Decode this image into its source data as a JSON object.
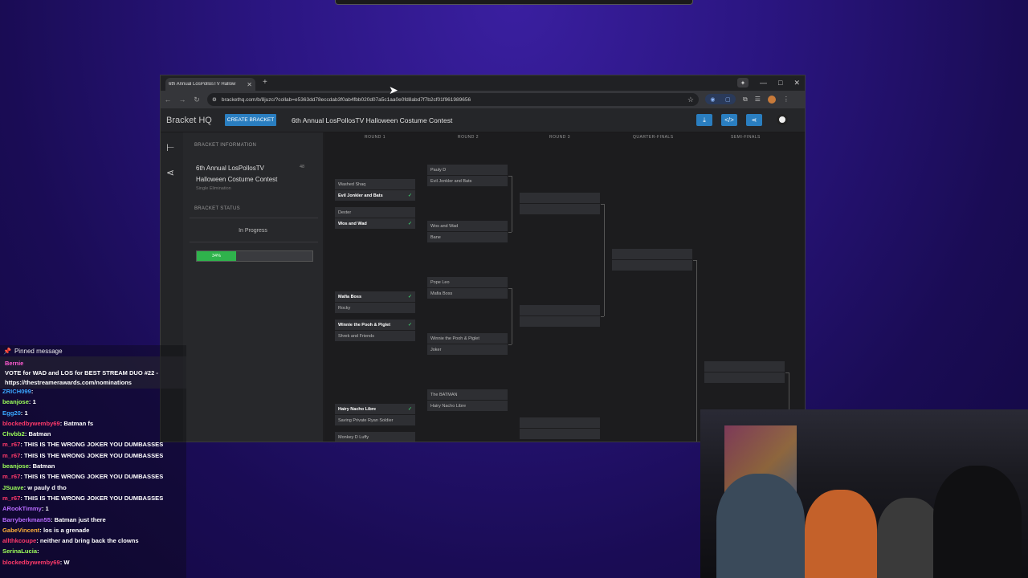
{
  "browser": {
    "tab_title": "6th Annual LosPollosTV Hallow",
    "url": "brackethq.com/b/8juzc/?collab=e5363dd78eccdab3f0ab4fbb020d07a5c1aa0e0fd8abd7f7b2cf01f961989656"
  },
  "app": {
    "logo": "Bracket HQ",
    "create_button": "CREATE BRACKET",
    "title": "6th Annual LosPollosTV Halloween Costume Contest"
  },
  "info_panel": {
    "info_label": "BRACKET INFORMATION",
    "name": "6th Annual LosPollosTV Halloween Costume Contest",
    "type": "Single Elimination",
    "count": "48",
    "status_label": "BRACKET STATUS",
    "status": "In Progress",
    "progress_text": "34%",
    "progress_value": 0.34
  },
  "rounds": [
    "ROUND 1",
    "ROUND 2",
    "ROUND 3",
    "QUARTER-FINALS",
    "SEMI-FINALS"
  ],
  "round1": [
    {
      "a": "Washed Shaq",
      "b": "Evil Jonkler and Bats",
      "winner": "b"
    },
    {
      "a": "Dexter",
      "b": "Wos and Wad",
      "winner": "b"
    },
    {
      "a": "Mafia Boss",
      "b": "Rocky",
      "winner": "a"
    },
    {
      "a": "Winnie the Pooh & Piglet",
      "b": "Shrek and Friends",
      "winner": "a"
    },
    {
      "a": "Hairy Nacho Libre",
      "b": "Saving Private Ryan Soldier",
      "winner": "a"
    },
    {
      "a": "Monkey D Luffy",
      "b": "",
      "winner": ""
    }
  ],
  "round2": [
    {
      "a": "Pauly D",
      "b": "Evil Jonkler and Bats"
    },
    {
      "a": "Wos and Wad",
      "b": "Bane"
    },
    {
      "a": "Pope Leo",
      "b": "Mafia Boss"
    },
    {
      "a": "Winnie the Pooh & Piglet",
      "b": "Joker"
    },
    {
      "a": "The BATMAN",
      "b": "Hairy Nacho Libre"
    }
  ],
  "chat": {
    "pinned_label": "Pinned message",
    "pinned_user": "Bernie",
    "pinned_text": "VOTE for WAD and LOS for BEST STREAM DUO #22 - https://thestreamerawards.com/nominations",
    "messages": [
      {
        "user": "ZRICH099",
        "text": "",
        "color": "#3aa7ff"
      },
      {
        "user": "beanjose",
        "text": "1",
        "color": "#9dff5a"
      },
      {
        "user": "Egg20",
        "text": "1",
        "color": "#3aa7ff"
      },
      {
        "user": "blockedbywemby69",
        "text": "Batman fs",
        "color": "#ff3a6a"
      },
      {
        "user": "Chvbb2",
        "text": "Batman",
        "color": "#9dff5a"
      },
      {
        "user": "m_r67",
        "text": "THIS IS THE WRONG JOKER YOU DUMBASSES",
        "color": "#ff3a6a"
      },
      {
        "user": "m_r67",
        "text": "THIS IS THE WRONG JOKER YOU DUMBASSES",
        "color": "#ff3a6a"
      },
      {
        "user": "beanjose",
        "text": "Batman",
        "color": "#9dff5a"
      },
      {
        "user": "m_r67",
        "text": "THIS IS THE WRONG JOKER YOU DUMBASSES",
        "color": "#ff3a6a"
      },
      {
        "user": "JSuave",
        "text": "w pauly d tho",
        "color": "#9dff5a"
      },
      {
        "user": "m_r67",
        "text": "THIS IS THE WRONG JOKER YOU DUMBASSES",
        "color": "#ff3a6a"
      },
      {
        "user": "ARookTimmy",
        "text": "1",
        "color": "#b86bff"
      },
      {
        "user": "Barryberkman55",
        "text": "Batman just there",
        "color": "#b86bff"
      },
      {
        "user": "GabeVincent",
        "text": "los is a grenade",
        "color": "#ffb13a"
      },
      {
        "user": "allthkcoupe",
        "text": "neither and bring back the clowns",
        "color": "#ff3a6a"
      },
      {
        "user": "SerinaLucia",
        "text": "",
        "color": "#9dff5a"
      },
      {
        "user": "blockedbywemby69",
        "text": "W",
        "color": "#ff3a6a"
      }
    ]
  }
}
